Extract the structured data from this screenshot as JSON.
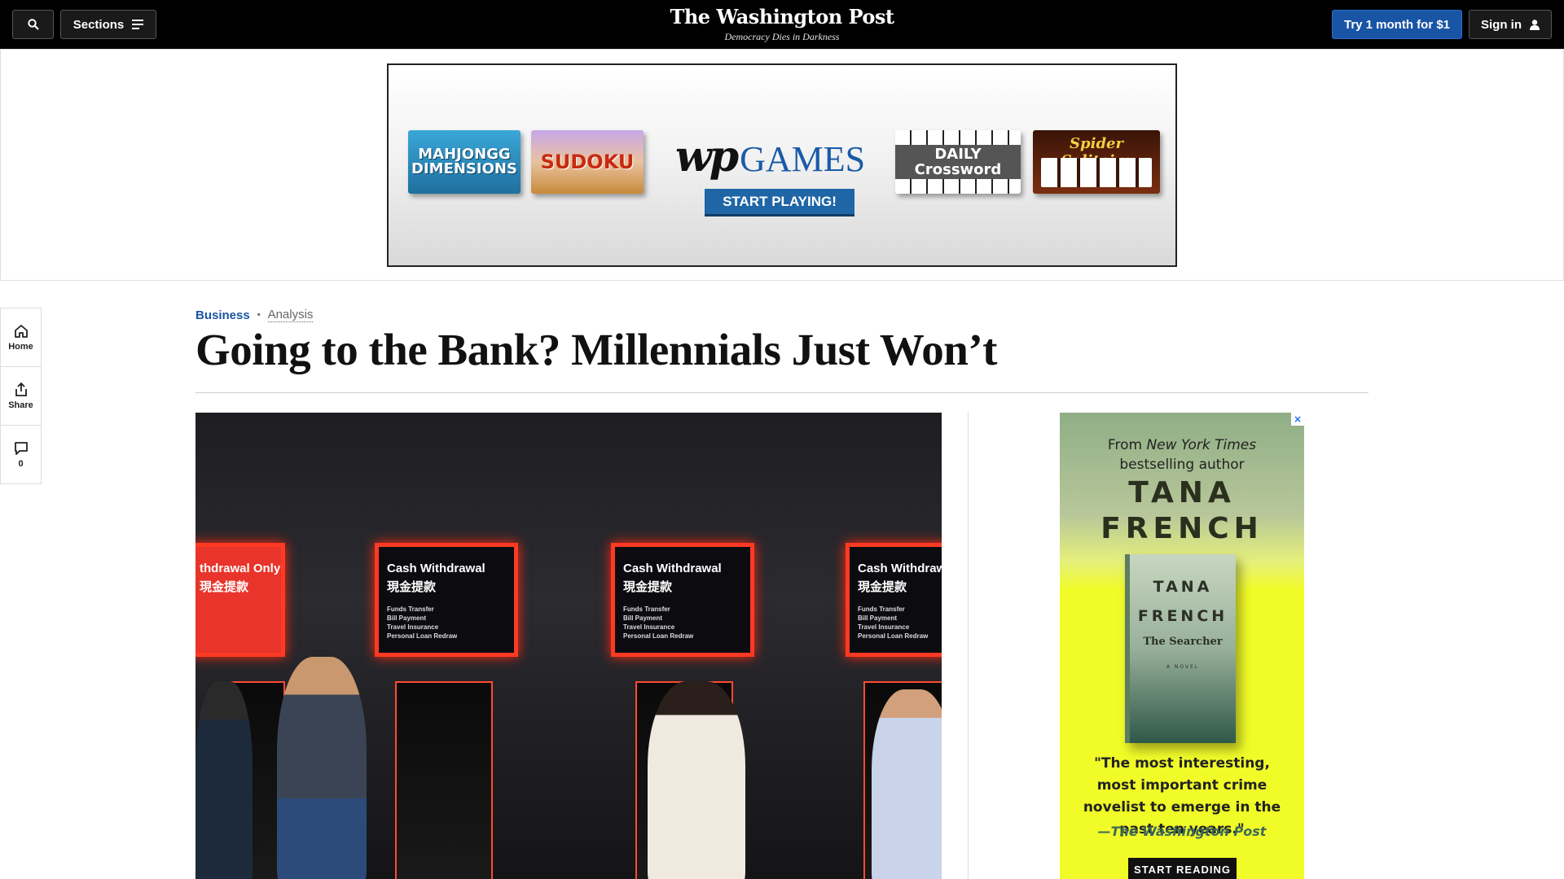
{
  "topnav": {
    "sections_label": "Sections",
    "logo": "The Washington Post",
    "tagline": "Democracy Dies in Darkness",
    "subscribe_label": "Try 1 month for $1",
    "signin_label": "Sign in"
  },
  "top_ad": {
    "tiles": [
      "MAHJONGG DIMENSIONS",
      "SUDOKU",
      "DAILY Crossword",
      "Spider Solitaire"
    ],
    "logo_wp": "wp",
    "logo_games": "GAMES",
    "cta": "START PLAYING!"
  },
  "rail": {
    "home": "Home",
    "share": "Share",
    "comments_count": "0"
  },
  "article": {
    "section": "Business",
    "label": "Analysis",
    "headline": "Going to the Bank? Millennials Just Won’t"
  },
  "photo": {
    "panel_title": "Cash Withdrawal",
    "panel_title_only": "thdrawal Only",
    "panel_cn": "現金提款",
    "panel_items": [
      "Funds Transfer",
      "Bill Payment",
      "Travel Insurance",
      "Personal Loan Redraw"
    ]
  },
  "book_ad": {
    "close": "×",
    "from": "From",
    "nyt": "New York Times",
    "bestselling": "bestselling author",
    "author_first": "TANA",
    "author_last": "FRENCH",
    "book_title": "The Searcher",
    "book_novel": "A NOVEL",
    "quote": "\"The most interesting, most important crime novelist to emerge in the past ten years.\"",
    "attribution": "—The Washington Post",
    "cta": "START READING"
  },
  "colors": {
    "brand_blue": "#1955a5",
    "nav_bg": "#000000",
    "atm_red": "#ff3a24",
    "ad_yellow": "#f0fb28"
  }
}
